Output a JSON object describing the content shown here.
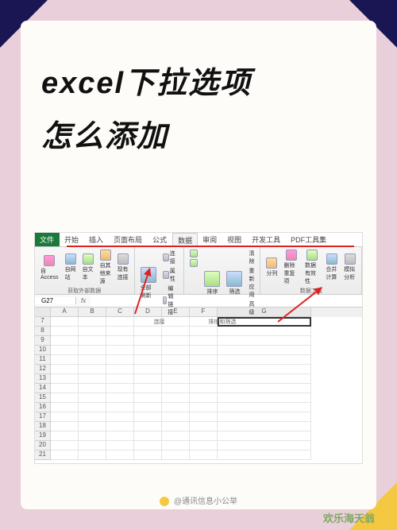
{
  "title_line1": "excel下拉选项",
  "title_line2": "怎么添加",
  "tabs": {
    "file": "文件",
    "home": "开始",
    "insert": "插入",
    "layout": "页面布局",
    "formula": "公式",
    "data": "数据",
    "review": "审阅",
    "view": "视图",
    "dev": "开发工具",
    "pdf": "PDF工具集"
  },
  "ribbon": {
    "group1": {
      "access": "自 Access",
      "web": "自网站",
      "text": "自文本",
      "other": "自其他来源",
      "existing": "现有连接",
      "label": "获取外部数据"
    },
    "group2": {
      "refresh": "全部刷新",
      "connections": "连接",
      "properties": "属性",
      "editlinks": "编辑链接",
      "label": "连接"
    },
    "group3": {
      "az": "升序",
      "za": "降序",
      "sort": "排序",
      "filter": "筛选",
      "clear": "清除",
      "reapply": "重新应用",
      "advanced": "高级",
      "label": "排序和筛选"
    },
    "group4": {
      "texttocol": "分列",
      "removedupes": "删除重复项",
      "validation": "数据有效性",
      "consolidate": "合并计算",
      "whatif": "模拟分析",
      "label": "数据工具"
    }
  },
  "namebox": "G27",
  "columns": [
    "A",
    "B",
    "C",
    "D",
    "E",
    "F",
    "G"
  ],
  "rows": [
    7,
    8,
    9,
    10,
    11,
    12,
    13,
    14,
    15,
    16,
    17,
    18,
    19,
    20,
    21
  ],
  "watermark": "欢乐海天翁",
  "credit": "@通讯信息小公举"
}
